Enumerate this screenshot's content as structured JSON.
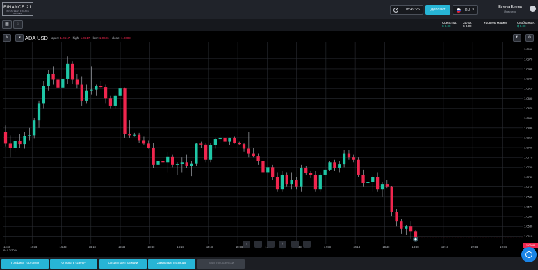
{
  "header": {
    "logo_main": "FINANCE 21",
    "logo_sub": "INVESTMENT FINANCE BROKER",
    "time": "18:49:26",
    "deposit_label": "Депозит",
    "lang_code": "RU",
    "user_name": "Елена Елена",
    "user_role": "Инвестор"
  },
  "account": {
    "funds_label": "Средства:",
    "funds_value": "$ 0.00",
    "margin_label": "Залог:",
    "margin_value": "$ 0.00",
    "margin_level_label": "Уровень Маржи:",
    "margin_level_value": "-",
    "free_label": "Свободные:",
    "free_value": "$ 0.00"
  },
  "chart_header": {
    "pair": "ADA USD",
    "open_label": "open:",
    "open_value": "1.0617",
    "high_label": "high:",
    "high_value": "1.0617",
    "low_label": "low:",
    "low_value": "1.0606",
    "close_label": "close:",
    "close_value": "1.0609"
  },
  "nav_controls": [
    "‹",
    "−",
    "−",
    "+",
    "+",
    "›"
  ],
  "colors": {
    "up": "#1fc7a6",
    "down": "#f0264e",
    "accent": "#27b5d6"
  },
  "chart_data": {
    "type": "candlestick",
    "y_ticks": [
      "1.0990",
      "1.0970",
      "1.0950",
      "1.0930",
      "1.0910",
      "1.0890",
      "1.0870",
      "1.0850",
      "1.0830",
      "1.0810",
      "1.0790",
      "1.0770",
      "1.0750",
      "1.0730",
      "1.0710",
      "1.0690",
      "1.0670",
      "1.0650",
      "1.0630",
      "1.0610"
    ],
    "ylim": [
      1.0595,
      1.1005
    ],
    "x_ticks": [
      "13:45\n04/12/2024",
      "14:15",
      "14:35",
      "15:15",
      "15:35",
      "15:55",
      "16:15",
      "16:35",
      "16:55",
      "17:15",
      "17:35",
      "17:55",
      "18:15",
      "18:35",
      "18:55",
      "19:15",
      "19:35",
      "19:55"
    ],
    "last_price": "1.0608",
    "candles": [
      {
        "o": 1.0822,
        "h": 1.0835,
        "l": 1.0792,
        "c": 1.0798
      },
      {
        "o": 1.0798,
        "h": 1.0815,
        "l": 1.077,
        "c": 1.079
      },
      {
        "o": 1.079,
        "h": 1.0812,
        "l": 1.078,
        "c": 1.0803
      },
      {
        "o": 1.0803,
        "h": 1.0818,
        "l": 1.079,
        "c": 1.0797
      },
      {
        "o": 1.0797,
        "h": 1.0822,
        "l": 1.0788,
        "c": 1.0813
      },
      {
        "o": 1.0813,
        "h": 1.083,
        "l": 1.0805,
        "c": 1.0815
      },
      {
        "o": 1.0815,
        "h": 1.085,
        "l": 1.0808,
        "c": 1.0845
      },
      {
        "o": 1.0845,
        "h": 1.0885,
        "l": 1.083,
        "c": 1.088
      },
      {
        "o": 1.088,
        "h": 1.0925,
        "l": 1.087,
        "c": 1.0915
      },
      {
        "o": 1.0915,
        "h": 1.0947,
        "l": 1.0905,
        "c": 1.094
      },
      {
        "o": 1.094,
        "h": 1.0955,
        "l": 1.0918,
        "c": 1.0928
      },
      {
        "o": 1.0928,
        "h": 1.0935,
        "l": 1.0905,
        "c": 1.0912
      },
      {
        "o": 1.0912,
        "h": 1.0935,
        "l": 1.0905,
        "c": 1.093
      },
      {
        "o": 1.093,
        "h": 1.0975,
        "l": 1.092,
        "c": 1.096
      },
      {
        "o": 1.096,
        "h": 1.0965,
        "l": 1.092,
        "c": 1.0928
      },
      {
        "o": 1.0928,
        "h": 1.094,
        "l": 1.091,
        "c": 1.0918
      },
      {
        "o": 1.0918,
        "h": 1.0935,
        "l": 1.0875,
        "c": 1.0885
      },
      {
        "o": 1.0885,
        "h": 1.0918,
        "l": 1.088,
        "c": 1.0905
      },
      {
        "o": 1.0905,
        "h": 1.0955,
        "l": 1.0898,
        "c": 1.0908
      },
      {
        "o": 1.0908,
        "h": 1.0918,
        "l": 1.0895,
        "c": 1.0915
      },
      {
        "o": 1.0915,
        "h": 1.0925,
        "l": 1.091,
        "c": 1.0913
      },
      {
        "o": 1.0913,
        "h": 1.0918,
        "l": 1.088,
        "c": 1.089
      },
      {
        "o": 1.089,
        "h": 1.0895,
        "l": 1.087,
        "c": 1.0875
      },
      {
        "o": 1.0875,
        "h": 1.0898,
        "l": 1.087,
        "c": 1.0895
      },
      {
        "o": 1.0895,
        "h": 1.0915,
        "l": 1.089,
        "c": 1.091
      },
      {
        "o": 1.091,
        "h": 1.0912,
        "l": 1.081,
        "c": 1.0818
      },
      {
        "o": 1.0818,
        "h": 1.0845,
        "l": 1.081,
        "c": 1.0815
      },
      {
        "o": 1.0815,
        "h": 1.082,
        "l": 1.0812,
        "c": 1.0816
      },
      {
        "o": 1.0816,
        "h": 1.082,
        "l": 1.08,
        "c": 1.0805
      },
      {
        "o": 1.0805,
        "h": 1.0812,
        "l": 1.0796,
        "c": 1.0798
      },
      {
        "o": 1.0798,
        "h": 1.0805,
        "l": 1.0788,
        "c": 1.079
      },
      {
        "o": 1.079,
        "h": 1.08,
        "l": 1.0748,
        "c": 1.0755
      },
      {
        "o": 1.0755,
        "h": 1.077,
        "l": 1.075,
        "c": 1.0762
      },
      {
        "o": 1.0762,
        "h": 1.0775,
        "l": 1.0755,
        "c": 1.076
      },
      {
        "o": 1.076,
        "h": 1.078,
        "l": 1.074,
        "c": 1.0772
      },
      {
        "o": 1.0772,
        "h": 1.0775,
        "l": 1.075,
        "c": 1.0755
      },
      {
        "o": 1.0755,
        "h": 1.076,
        "l": 1.0735,
        "c": 1.0757
      },
      {
        "o": 1.0757,
        "h": 1.077,
        "l": 1.074,
        "c": 1.076
      },
      {
        "o": 1.076,
        "h": 1.0775,
        "l": 1.0748,
        "c": 1.0752
      },
      {
        "o": 1.0752,
        "h": 1.0762,
        "l": 1.0732,
        "c": 1.0758
      },
      {
        "o": 1.0758,
        "h": 1.08,
        "l": 1.0752,
        "c": 1.0798
      },
      {
        "o": 1.0798,
        "h": 1.0802,
        "l": 1.079,
        "c": 1.0796
      },
      {
        "o": 1.0796,
        "h": 1.08,
        "l": 1.076,
        "c": 1.0765
      },
      {
        "o": 1.0765,
        "h": 1.08,
        "l": 1.076,
        "c": 1.0795
      },
      {
        "o": 1.0795,
        "h": 1.081,
        "l": 1.0788,
        "c": 1.0807
      },
      {
        "o": 1.0807,
        "h": 1.0818,
        "l": 1.08,
        "c": 1.081
      },
      {
        "o": 1.081,
        "h": 1.0815,
        "l": 1.08,
        "c": 1.0802
      },
      {
        "o": 1.0802,
        "h": 1.081,
        "l": 1.0795,
        "c": 1.081
      },
      {
        "o": 1.081,
        "h": 1.0812,
        "l": 1.0798,
        "c": 1.08
      },
      {
        "o": 1.08,
        "h": 1.0802,
        "l": 1.0795,
        "c": 1.0797
      },
      {
        "o": 1.0797,
        "h": 1.08,
        "l": 1.0782,
        "c": 1.0788
      },
      {
        "o": 1.0788,
        "h": 1.0822,
        "l": 1.077,
        "c": 1.0778
      },
      {
        "o": 1.0778,
        "h": 1.079,
        "l": 1.077,
        "c": 1.0773
      },
      {
        "o": 1.0773,
        "h": 1.0778,
        "l": 1.0755,
        "c": 1.0762
      },
      {
        "o": 1.0762,
        "h": 1.077,
        "l": 1.0735,
        "c": 1.074
      },
      {
        "o": 1.074,
        "h": 1.0755,
        "l": 1.0728,
        "c": 1.075
      },
      {
        "o": 1.075,
        "h": 1.0755,
        "l": 1.0725,
        "c": 1.073
      },
      {
        "o": 1.073,
        "h": 1.074,
        "l": 1.07,
        "c": 1.0705
      },
      {
        "o": 1.0705,
        "h": 1.0742,
        "l": 1.07,
        "c": 1.0735
      },
      {
        "o": 1.0735,
        "h": 1.074,
        "l": 1.071,
        "c": 1.0715
      },
      {
        "o": 1.0715,
        "h": 1.074,
        "l": 1.0705,
        "c": 1.0725
      },
      {
        "o": 1.0725,
        "h": 1.073,
        "l": 1.0705,
        "c": 1.071
      },
      {
        "o": 1.071,
        "h": 1.0755,
        "l": 1.07,
        "c": 1.0748
      },
      {
        "o": 1.0748,
        "h": 1.0752,
        "l": 1.0735,
        "c": 1.0738
      },
      {
        "o": 1.0738,
        "h": 1.0742,
        "l": 1.0728,
        "c": 1.0735
      },
      {
        "o": 1.0735,
        "h": 1.0742,
        "l": 1.07,
        "c": 1.0705
      },
      {
        "o": 1.0705,
        "h": 1.074,
        "l": 1.07,
        "c": 1.0735
      },
      {
        "o": 1.0735,
        "h": 1.0748,
        "l": 1.073,
        "c": 1.0745
      },
      {
        "o": 1.0745,
        "h": 1.0762,
        "l": 1.0742,
        "c": 1.076
      },
      {
        "o": 1.076,
        "h": 1.0765,
        "l": 1.0742,
        "c": 1.0748
      },
      {
        "o": 1.0748,
        "h": 1.0762,
        "l": 1.074,
        "c": 1.0756
      },
      {
        "o": 1.0756,
        "h": 1.0785,
        "l": 1.075,
        "c": 1.0778
      },
      {
        "o": 1.0778,
        "h": 1.0785,
        "l": 1.0765,
        "c": 1.077
      },
      {
        "o": 1.077,
        "h": 1.0775,
        "l": 1.076,
        "c": 1.0765
      },
      {
        "o": 1.0765,
        "h": 1.077,
        "l": 1.073,
        "c": 1.0735
      },
      {
        "o": 1.0735,
        "h": 1.0745,
        "l": 1.071,
        "c": 1.0718
      },
      {
        "o": 1.0718,
        "h": 1.0725,
        "l": 1.071,
        "c": 1.072
      },
      {
        "o": 1.072,
        "h": 1.0735,
        "l": 1.07,
        "c": 1.073
      },
      {
        "o": 1.073,
        "h": 1.074,
        "l": 1.07,
        "c": 1.0705
      },
      {
        "o": 1.0705,
        "h": 1.072,
        "l": 1.069,
        "c": 1.0715
      },
      {
        "o": 1.0715,
        "h": 1.0725,
        "l": 1.0708,
        "c": 1.071
      },
      {
        "o": 1.071,
        "h": 1.0712,
        "l": 1.065,
        "c": 1.066
      },
      {
        "o": 1.066,
        "h": 1.0665,
        "l": 1.063,
        "c": 1.064
      },
      {
        "o": 1.064,
        "h": 1.0645,
        "l": 1.0615,
        "c": 1.0625
      },
      {
        "o": 1.0625,
        "h": 1.0632,
        "l": 1.0612,
        "c": 1.063
      },
      {
        "o": 1.063,
        "h": 1.064,
        "l": 1.0605,
        "c": 1.062
      },
      {
        "o": 1.062,
        "h": 1.0622,
        "l": 1.0604,
        "c": 1.0608
      }
    ]
  },
  "bottom_tabs": [
    {
      "label": "Графики торговли",
      "disabled": false
    },
    {
      "label": "Открыть сделку",
      "disabled": false
    },
    {
      "label": "Открытые Позиции",
      "disabled": false
    },
    {
      "label": "Закрытые Позиции",
      "disabled": false
    },
    {
      "label": "Криптокошельки",
      "disabled": true
    }
  ]
}
